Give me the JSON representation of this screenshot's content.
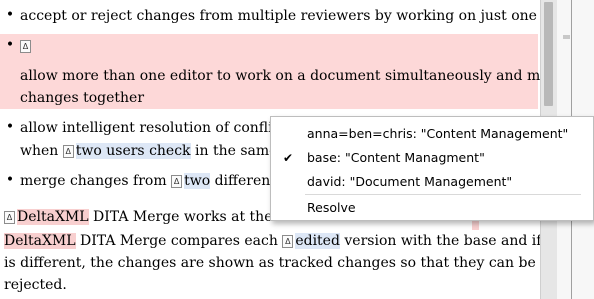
{
  "document": {
    "bullet1": "accept or reject changes from multiple reviewers by working on just one document",
    "bullet2_text": "allow more than one editor to work on a document simultaneously and merge their",
    "bullet2_text_line2": "changes together",
    "bullet3_line1": "allow intelligent resolution of conflicts in a",
    "bullet3_line2_before": "when",
    "bullet3_line2_hl": "two users check",
    "bullet3_line2_mid": "in the same",
    "bullet3_line2_frag": "e",
    "bullet4_before": "merge changes from",
    "bullet4_hl": "two",
    "bullet4_after": "different bran",
    "para_l1_brand": "DeltaXML",
    "para_l1_rest": "DITA Merge works at the lev",
    "para_l2_brand": "DeltaXML",
    "para_l2_rest1": "DITA Merge compares each",
    "para_l2_hl": "edited",
    "para_l2_rest2": "version with the base and if only one",
    "para_l3": "is different, the changes are shown as tracked changes so that they can be accepted or",
    "para_l4": "rejected.",
    "change_marker": "Δ",
    "bullet_glyph": "•"
  },
  "context_menu": {
    "items": [
      {
        "label": "anna=ben=chris: \"Content Management\"",
        "checked": false
      },
      {
        "label": "base: \"Content Managment\"",
        "checked": true
      },
      {
        "label": "david: \"Document Management\"",
        "checked": false
      }
    ],
    "resolve_label": "Resolve",
    "check_glyph": "✔"
  },
  "colors": {
    "change_highlight": "#dde7f6",
    "deletion_background": "#fdd8d8",
    "brand_highlight": "#f8cfcf"
  }
}
